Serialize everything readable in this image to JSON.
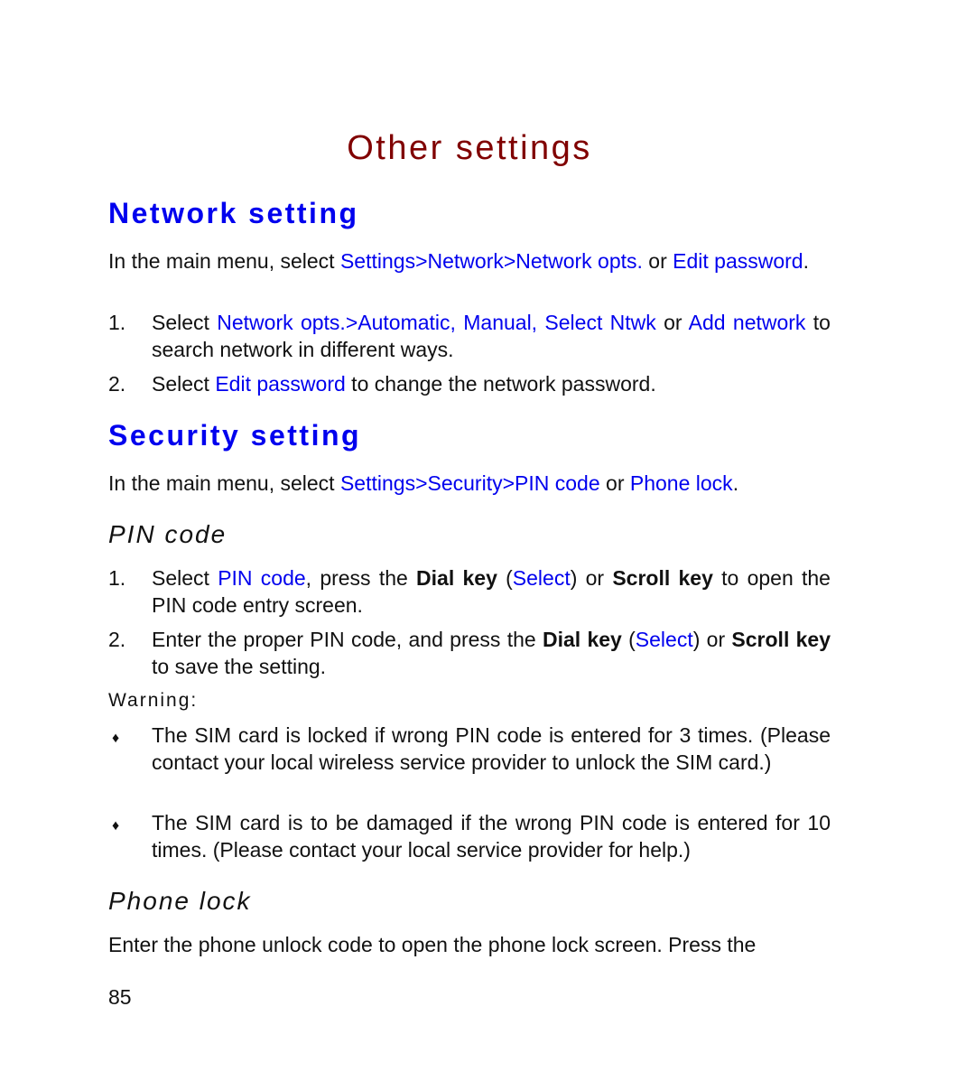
{
  "document": {
    "title": "Other settings",
    "colors": {
      "title": "#800000",
      "heading": "#0000ee",
      "link": "#0000ee",
      "text": "#111111"
    },
    "network": {
      "heading": "Network setting",
      "intro": {
        "t1": "In the main menu, select ",
        "l1": "Settings>Network>Network opts.",
        "t2": " or ",
        "l2": "Edit password",
        "t3": "."
      },
      "steps": [
        {
          "num": "1.",
          "t1": "Select ",
          "l1": "Network opts.>Automatic, Manual, Select Ntwk",
          "t2": " or ",
          "l2": "Add network",
          "t3": " to search network in different ways."
        },
        {
          "num": "2.",
          "t1": "Select ",
          "l1": "Edit password",
          "t2": " to change the network password."
        }
      ]
    },
    "security": {
      "heading": "Security setting",
      "intro": {
        "t1": "In the main menu, select ",
        "l1": "Settings>Security>PIN code",
        "t2": " or ",
        "l2": "Phone lock",
        "t3": "."
      },
      "pin_code": {
        "heading": "PIN code",
        "steps": [
          {
            "num": "1.",
            "t1": "Select ",
            "l1": "PIN code",
            "t2": ", press the ",
            "b1": "Dial key",
            "t3": " (",
            "l2": "Select",
            "t4": ") or ",
            "b2": "Scroll key",
            "t5": " to open the PIN code entry screen."
          },
          {
            "num": "2.",
            "t1": "Enter the proper PIN code, and press the ",
            "b1": "Dial key",
            "t2": " (",
            "l1": "Select",
            "t3": ") or ",
            "b2": "Scroll key",
            "t4": " to save the setting."
          }
        ],
        "warning_label": "Warning:",
        "bullet_icon": "diamond-bullet",
        "warnings": [
          "The SIM card is locked if wrong PIN code is entered for 3 times. (Please contact your local wireless service provider to unlock the SIM card.)",
          "The SIM card is to be damaged if the wrong PIN code is entered for 10 times. (Please contact your local service provider for help.)"
        ]
      },
      "phone_lock": {
        "heading": "Phone lock",
        "text": "Enter the phone unlock code to open the phone lock screen. Press the"
      }
    },
    "page_number": "85"
  }
}
